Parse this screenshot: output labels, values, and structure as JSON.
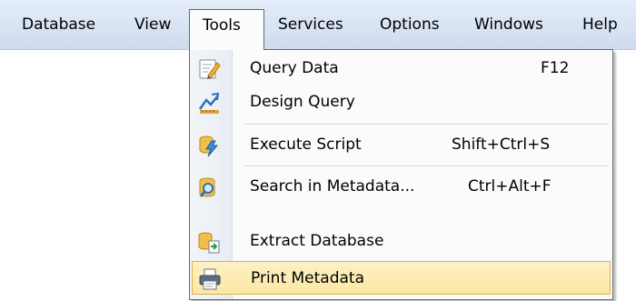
{
  "menubar": {
    "items": [
      {
        "label": "Database",
        "mnemonic": "D"
      },
      {
        "label": "View",
        "mnemonic": "V"
      },
      {
        "label": "Tools",
        "mnemonic": "T"
      },
      {
        "label": "Services",
        "mnemonic": "c"
      },
      {
        "label": "Options",
        "mnemonic": "O"
      },
      {
        "label": "Windows",
        "mnemonic": "W"
      },
      {
        "label": "Help",
        "mnemonic": "H"
      }
    ],
    "open_menu": "Tools"
  },
  "tools_menu": {
    "items": [
      {
        "label": "Query Data",
        "shortcut": "F12",
        "icon": "query-data-icon"
      },
      {
        "label": "Design Query",
        "shortcut": "",
        "icon": "design-query-icon"
      },
      {
        "label": "Execute Script",
        "shortcut": "Shift+Ctrl+S",
        "icon": "execute-script-icon"
      },
      {
        "label": "Search in Metadata...",
        "shortcut": "Ctrl+Alt+F",
        "icon": "search-metadata-icon"
      },
      {
        "label": "Extract Database",
        "shortcut": "",
        "icon": "extract-database-icon"
      },
      {
        "label": "Print Metadata",
        "shortcut": "",
        "icon": "print-metadata-icon",
        "highlighted": true
      }
    ]
  },
  "colors": {
    "menubar_bg": "#d6e2f2",
    "highlight_bg": "#fbe7a5",
    "highlight_border": "#d7b24a"
  }
}
